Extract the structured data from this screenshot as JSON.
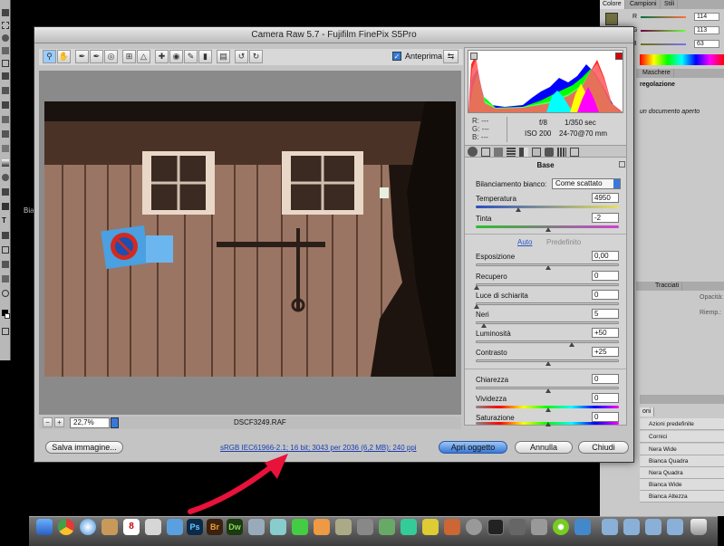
{
  "dialog": {
    "title": "Camera Raw 5.7  -  Fujifilm FinePix S5Pro",
    "preview_label": "Anteprima",
    "zoom": "22,7%",
    "filename": "DSCF3249.RAF",
    "workflow_link": "sRGB IEC61966-2.1; 16 bit; 3043 per 2036 (6,2 MB); 240 ppi",
    "save_button": "Salva immagine...",
    "open_button": "Apri oggetto",
    "cancel_button": "Annulla",
    "close_button": "Chiudi"
  },
  "info": {
    "r": "R:  ---",
    "g": "G:  ---",
    "b": "B:  ---",
    "aperture": "f/8",
    "shutter": "1/350 sec",
    "iso": "ISO 200",
    "lens": "24-70@70 mm"
  },
  "panel": {
    "section": "Base",
    "wb_label": "Bilanciamento bianco:",
    "wb_value": "Come scattato",
    "temp_label": "Temperatura",
    "temp_value": "4950",
    "tint_label": "Tinta",
    "tint_value": "-2",
    "auto": "Auto",
    "default": "Predefinito",
    "exposure_label": "Esposizione",
    "exposure_value": "0,00",
    "recovery_label": "Recupero",
    "recovery_value": "0",
    "fill_label": "Luce di schiarita",
    "fill_value": "0",
    "blacks_label": "Neri",
    "blacks_value": "5",
    "brightness_label": "Luminosità",
    "brightness_value": "+50",
    "contrast_label": "Contrasto",
    "contrast_value": "+25",
    "clarity_label": "Chiarezza",
    "clarity_value": "0",
    "vibrance_label": "Vividezza",
    "vibrance_value": "0",
    "saturation_label": "Saturazione",
    "saturation_value": "0"
  },
  "ps_panels": {
    "tab_colore": "Colore",
    "tab_campioni": "Campioni",
    "tab_stili": "Stili",
    "r_value": "114",
    "g_value": "113",
    "b_value": "63",
    "tab_maschere": "Maschere",
    "regolazione": "regolazione",
    "no_doc": "un documento aperto",
    "tab_tracciati": "Tracciati",
    "opacity": "Opacità:",
    "fill": "Riemp.:",
    "actions_tab": "oni",
    "actions": [
      "Azioni predefinite",
      "Cornici",
      "Nera Wide",
      "Bianca Quadra",
      "Nera Quadra",
      "Bianca Wide",
      "Bianca Altezza"
    ]
  },
  "desktop": {
    "left_label": "Bia"
  },
  "dock": {
    "ps": "Ps",
    "br": "Br",
    "dw": "Dw",
    "cal": "8"
  }
}
